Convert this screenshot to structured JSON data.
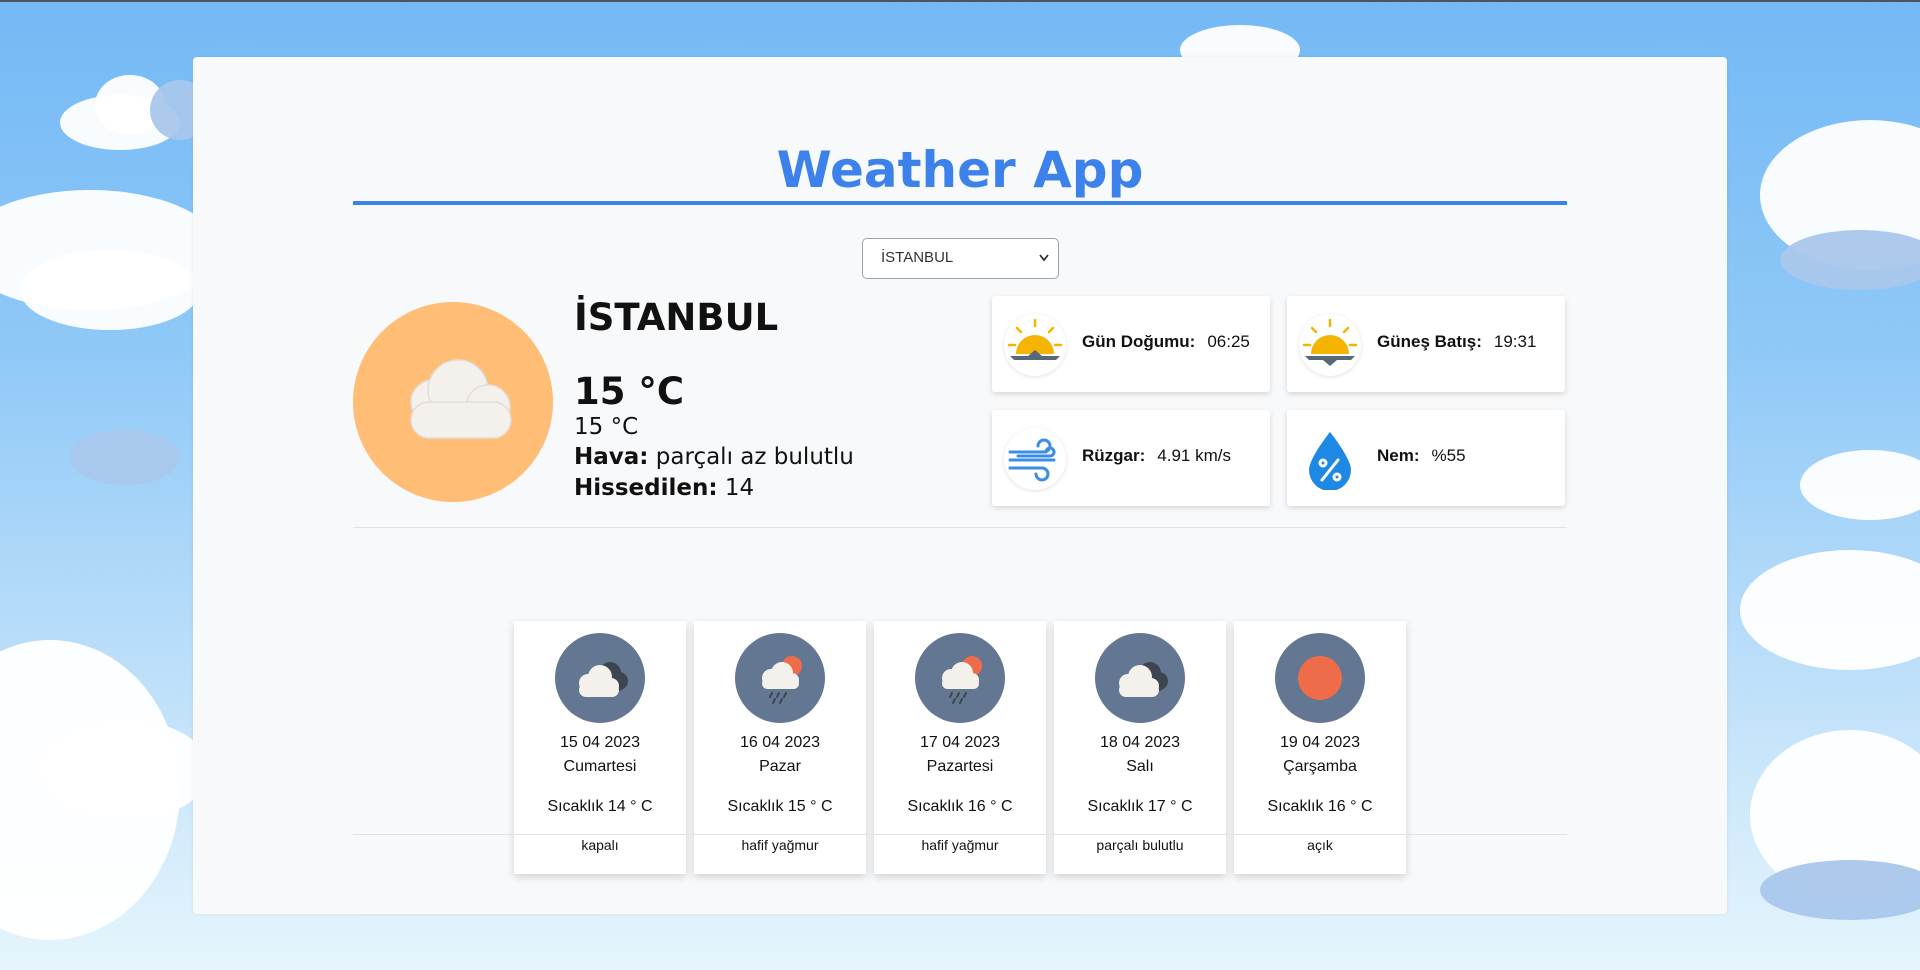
{
  "app": {
    "title": "Weather App"
  },
  "select": {
    "value": "İSTANBUL"
  },
  "current": {
    "city": "İSTANBUL",
    "temp_main": "15 °C",
    "temp_sub": "15 °C",
    "weather_label": "Hava:",
    "weather_value": "parçalı az bulutlu",
    "feels_label": "Hissedilen:",
    "feels_value": "14",
    "icon": "cloud-icon"
  },
  "info": {
    "sunrise": {
      "label": "Gün Doğumu:",
      "value": "06:25",
      "icon": "sunrise-icon"
    },
    "sunset": {
      "label": "Güneş Batış:",
      "value": "19:31",
      "icon": "sunset-icon"
    },
    "wind": {
      "label": "Rüzgar:",
      "value": "4.91 km/s",
      "icon": "wind-icon"
    },
    "humidity": {
      "label": "Nem:",
      "value": "%55",
      "icon": "humidity-icon"
    }
  },
  "forecast": [
    {
      "date": "15 04 2023",
      "day": "Cumartesi",
      "temp": "Sıcaklık 14 ° C",
      "desc": "kapalı",
      "icon": "overcast-icon"
    },
    {
      "date": "16 04 2023",
      "day": "Pazar",
      "temp": "Sıcaklık 15 ° C",
      "desc": "hafif yağmur",
      "icon": "light-rain-icon"
    },
    {
      "date": "17 04 2023",
      "day": "Pazartesi",
      "temp": "Sıcaklık 16 ° C",
      "desc": "hafif yağmur",
      "icon": "light-rain-icon"
    },
    {
      "date": "18 04 2023",
      "day": "Salı",
      "temp": "Sıcaklık 17 ° C",
      "desc": "parçalı bulutlu",
      "icon": "partly-cloudy-icon"
    },
    {
      "date": "19 04 2023",
      "day": "Çarşamba",
      "temp": "Sıcaklık 16 ° C",
      "desc": "açık",
      "icon": "clear-sun-icon"
    }
  ],
  "colors": {
    "accent": "#3c82ea",
    "current_icon_bg": "#ffbd75",
    "forecast_icon_bg": "#647792",
    "sun": "#f5b400",
    "drop": "#1e88e5"
  }
}
